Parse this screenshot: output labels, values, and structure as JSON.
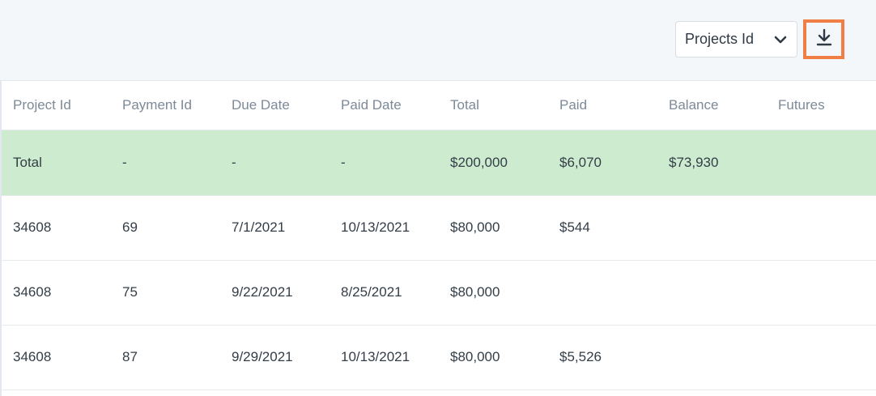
{
  "toolbar": {
    "group_by_value": "Projects Id",
    "dropdown_icon": "chevron-down-icon",
    "download_icon": "download-icon",
    "accent_color": "#f07f45"
  },
  "table": {
    "columns": [
      "Project Id",
      "Payment Id",
      "Due Date",
      "Paid Date",
      "Total",
      "Paid",
      "Balance",
      "Futures"
    ],
    "total_row": [
      "Total",
      "-",
      "-",
      "-",
      "$200,000",
      "$6,070",
      "$73,930",
      ""
    ],
    "rows": [
      [
        "34608",
        "69",
        "7/1/2021",
        "10/13/2021",
        "$80,000",
        "$544",
        "",
        ""
      ],
      [
        "34608",
        "75",
        "9/22/2021",
        "8/25/2021",
        "$80,000",
        "",
        "",
        ""
      ],
      [
        "34608",
        "87",
        "9/29/2021",
        "10/13/2021",
        "$80,000",
        "$5,526",
        "",
        ""
      ]
    ],
    "total_row_color": "#cdeccf"
  }
}
